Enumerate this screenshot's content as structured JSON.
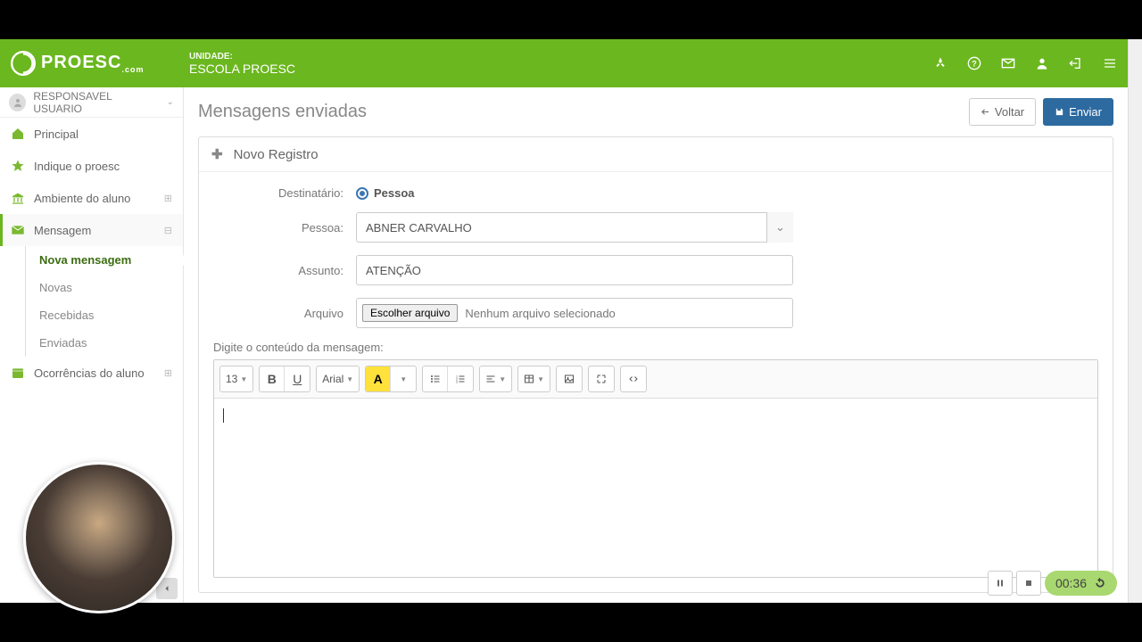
{
  "header": {
    "brand": "PROESC",
    "brand_sub": ".com",
    "unit_label": "UNIDADE:",
    "unit_name": "ESCOLA PROESC"
  },
  "sidebar": {
    "user": "RESPONSAVEL USUARIO",
    "items": [
      {
        "label": "Principal"
      },
      {
        "label": "Indique o proesc"
      },
      {
        "label": "Ambiente do aluno"
      },
      {
        "label": "Mensagem"
      },
      {
        "label": "Ocorrências do aluno"
      }
    ],
    "msg_sub": [
      {
        "label": "Nova mensagem"
      },
      {
        "label": "Novas"
      },
      {
        "label": "Recebidas"
      },
      {
        "label": "Enviadas"
      }
    ]
  },
  "page": {
    "title": "Mensagens enviadas",
    "back": "Voltar",
    "send": "Enviar"
  },
  "panel": {
    "title": "Novo Registro"
  },
  "form": {
    "dest_label": "Destinatário:",
    "dest_value": "Pessoa",
    "pessoa_label": "Pessoa:",
    "pessoa_value": "ABNER CARVALHO",
    "assunto_label": "Assunto:",
    "assunto_value": "ATENÇÃO",
    "arquivo_label": "Arquivo",
    "file_btn": "Escolher arquivo",
    "file_none": "Nenhum arquivo selecionado",
    "editor_label": "Digite o conteúdo da mensagem:"
  },
  "toolbar": {
    "fontsize": "13",
    "fontname": "Arial"
  },
  "recorder": {
    "time": "00:36"
  }
}
